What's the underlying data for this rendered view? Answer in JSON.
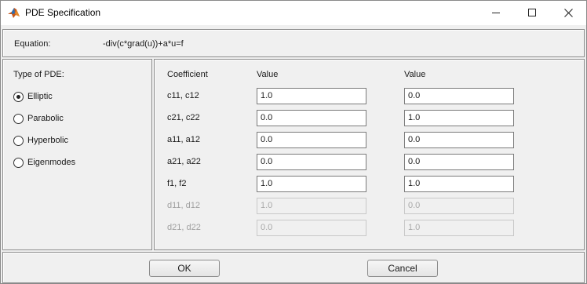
{
  "window": {
    "title": "PDE Specification"
  },
  "equation": {
    "label": "Equation:",
    "value": "-div(c*grad(u))+a*u=f"
  },
  "pde_type": {
    "label": "Type of PDE:",
    "options": [
      "Elliptic",
      "Parabolic",
      "Hyperbolic",
      "Eigenmodes"
    ],
    "selected": "Elliptic"
  },
  "coefficients": {
    "headers": [
      "Coefficient",
      "Value",
      "Value"
    ],
    "rows": [
      {
        "name": "c11, c12",
        "v1": "1.0",
        "v2": "0.0",
        "enabled": true
      },
      {
        "name": "c21, c22",
        "v1": "0.0",
        "v2": "1.0",
        "enabled": true
      },
      {
        "name": "a11, a12",
        "v1": "0.0",
        "v2": "0.0",
        "enabled": true
      },
      {
        "name": "a21, a22",
        "v1": "0.0",
        "v2": "0.0",
        "enabled": true
      },
      {
        "name": "f1, f2",
        "v1": "1.0",
        "v2": "1.0",
        "enabled": true
      },
      {
        "name": "d11, d12",
        "v1": "1.0",
        "v2": "0.0",
        "enabled": false
      },
      {
        "name": "d21, d22",
        "v1": "0.0",
        "v2": "1.0",
        "enabled": false
      }
    ]
  },
  "buttons": {
    "ok": "OK",
    "cancel": "Cancel"
  },
  "colors": {
    "titlebar": "#ffffff",
    "dialog_bg": "#f0f0f0",
    "disabled_text": "#a0a0a0"
  }
}
